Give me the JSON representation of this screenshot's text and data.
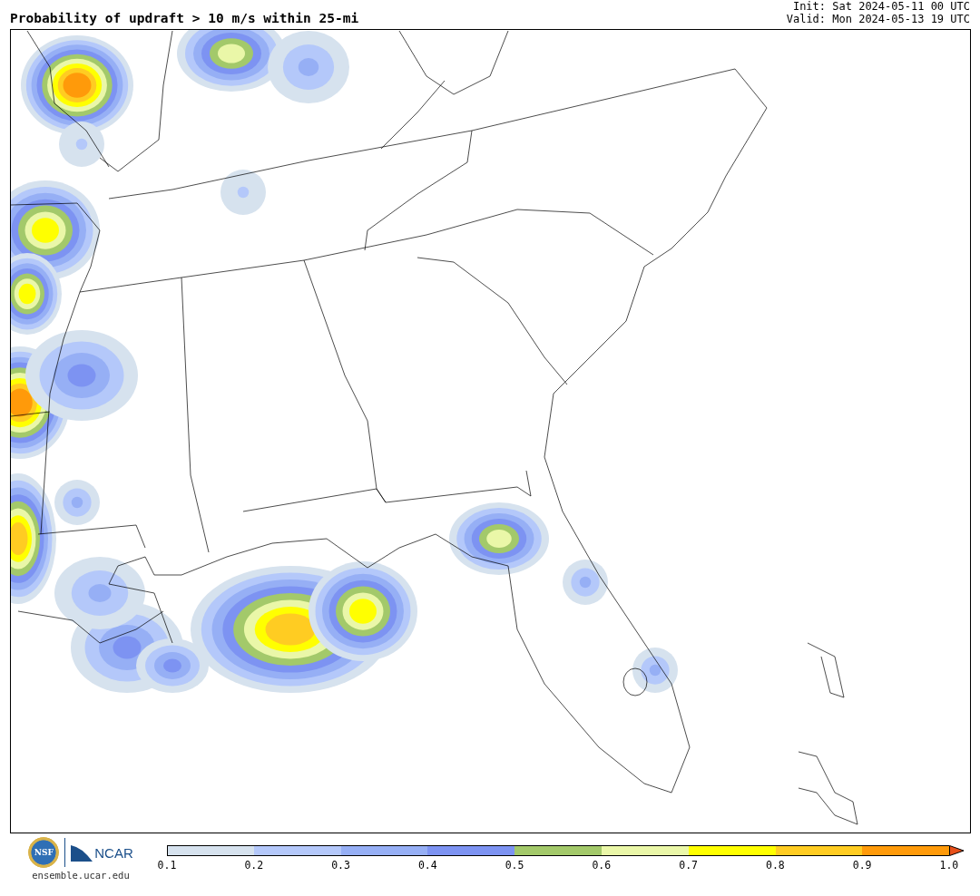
{
  "header": {
    "title": "Probability of updraft > 10 m/s within 25-mi",
    "init": "Init: Sat 2024-05-11 00 UTC",
    "valid": "Valid: Mon 2024-05-13 19 UTC"
  },
  "colorbar": {
    "bins": [
      {
        "color": "#d6e2ee"
      },
      {
        "color": "#b4c8fa"
      },
      {
        "color": "#96aff5"
      },
      {
        "color": "#7d93f2"
      },
      {
        "color": "#a3c96a"
      },
      {
        "color": "#eaf7a8"
      },
      {
        "color": "#ffff00"
      },
      {
        "color": "#ffcc22"
      },
      {
        "color": "#ff9a0a"
      }
    ],
    "extend": {
      "color": "#e8501a"
    },
    "ticks": [
      "0.1",
      "0.2",
      "0.3",
      "0.4",
      "0.5",
      "0.6",
      "0.7",
      "0.8",
      "0.9",
      "1.0"
    ]
  },
  "footer": {
    "nsf_logo_text": "NSF",
    "ncar_logo_text": "NCAR",
    "url": "ensemble.ucar.edu"
  }
}
